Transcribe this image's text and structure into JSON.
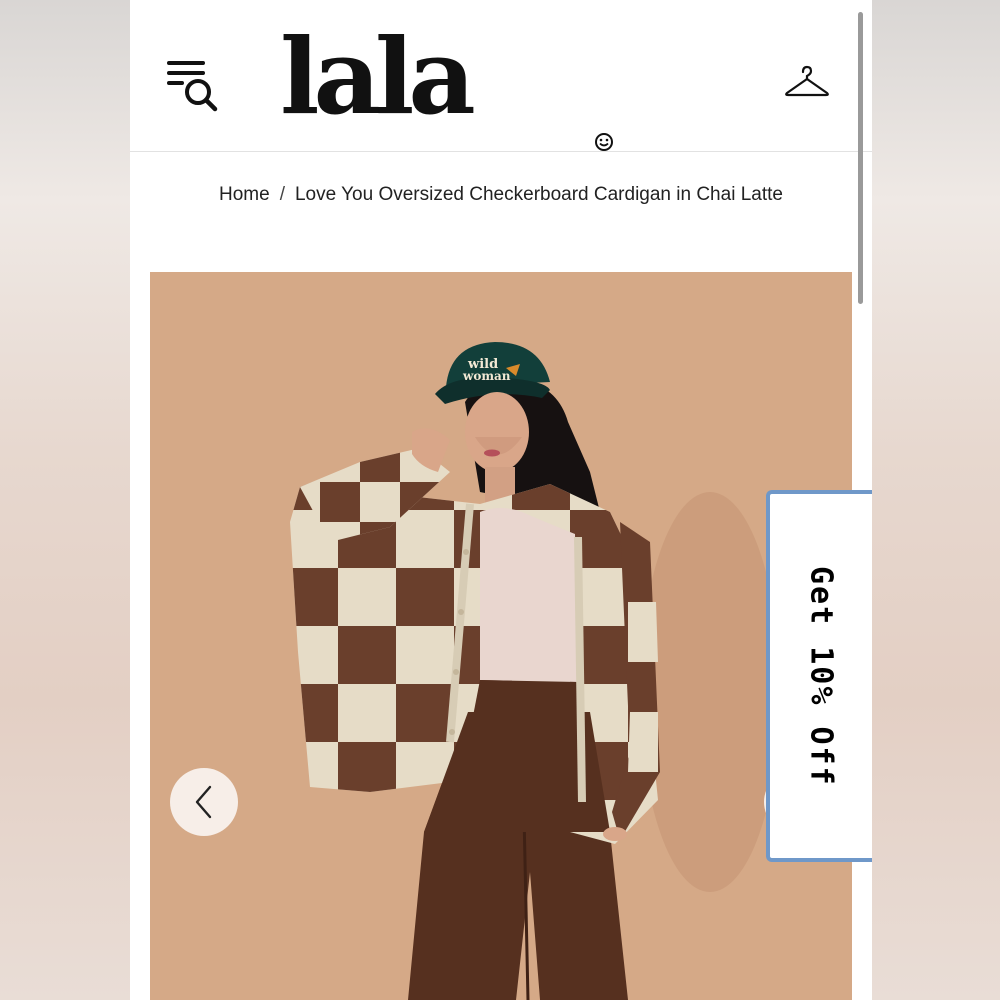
{
  "header": {
    "logo_text": "lala",
    "menu_search_icon": "menu-search-icon",
    "hanger_icon": "hanger-icon"
  },
  "breadcrumb": {
    "home": "Home",
    "separator": "/",
    "current": "Love You Oversized Checkerboard Cardigan in Chai Latte"
  },
  "product": {
    "hat_text_line1": "wild",
    "hat_text_line2": "woman",
    "prev_icon": "chevron-left-icon"
  },
  "promo": {
    "label": "Get 10% Off"
  },
  "colors": {
    "background_tan": "#d5a987",
    "cardigan_brown": "#6a3f2c",
    "cardigan_cream": "#e6dcc7",
    "promo_border": "#6f98c9"
  }
}
